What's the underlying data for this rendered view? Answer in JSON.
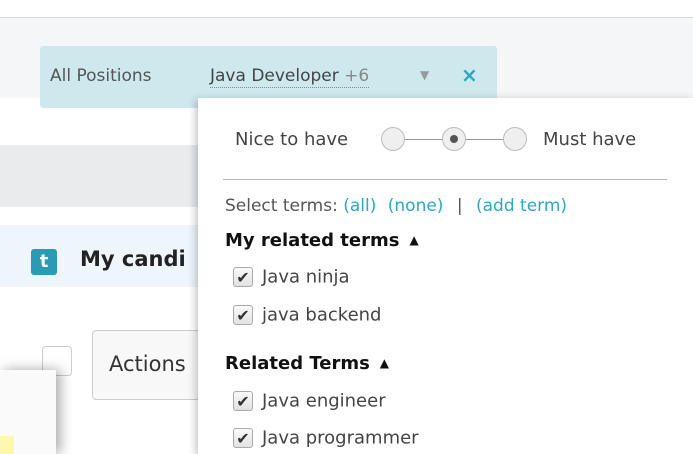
{
  "filter": {
    "label": "All Positions",
    "value": "Java Developer",
    "extra_count": "+6",
    "close_glyph": "×"
  },
  "candidates": {
    "icon_letter": "t",
    "title": "My candi"
  },
  "actions": {
    "label": "Actions"
  },
  "importance": {
    "left_label": "Nice to have",
    "right_label": "Must have",
    "selected_index": 1,
    "positions": 3
  },
  "select_terms": {
    "label": "Select terms:",
    "all": "(all)",
    "none": "(none)",
    "separator": "|",
    "add": "(add term)"
  },
  "sections": [
    {
      "title": "My related terms",
      "terms": [
        {
          "label": "Java ninja",
          "checked": true
        },
        {
          "label": "java backend",
          "checked": true
        }
      ]
    },
    {
      "title": "Related Terms",
      "terms": [
        {
          "label": "Java engineer",
          "checked": true
        },
        {
          "label": "Java programmer",
          "checked": true
        }
      ]
    }
  ],
  "colors": {
    "accent": "#2aa8c4",
    "chip_bg": "#cde9ee",
    "brand_icon": "#2b9bb3"
  }
}
